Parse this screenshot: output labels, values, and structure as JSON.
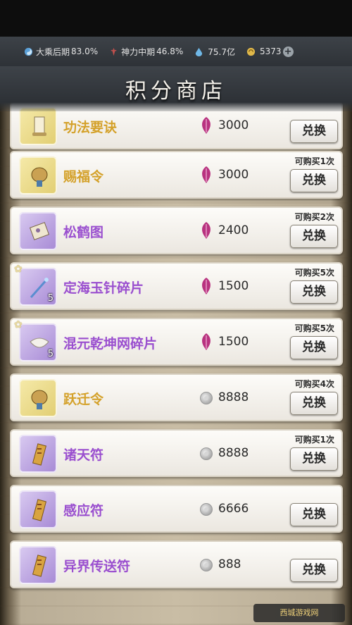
{
  "resources": [
    {
      "icon": "cultivation-icon",
      "label": "大乘后期",
      "value": "83.0%",
      "color": "#5aa0d8"
    },
    {
      "icon": "divine-power-icon",
      "label": "神力中期",
      "value": "46.8%",
      "color": "#c0504d"
    },
    {
      "icon": "spirit-drop-icon",
      "label": "",
      "value": "75.7亿",
      "color": "#6fb7e6"
    },
    {
      "icon": "gold-coin-icon",
      "label": "",
      "value": "5373",
      "color": "#e0b84a"
    }
  ],
  "shop": {
    "title": "积分商店",
    "items": [
      {
        "name": "功法要诀",
        "price": "3000",
        "currency": "points-feather-icon",
        "limit": "",
        "qty": "",
        "rarity": "yellow",
        "starred": false,
        "thumb_icon": "scroll-icon"
      },
      {
        "name": "赐福令",
        "price": "3000",
        "currency": "points-feather-icon",
        "limit": "可购买1次",
        "qty": "",
        "rarity": "yellow",
        "starred": false,
        "thumb_icon": "token-icon"
      },
      {
        "name": "松鹤图",
        "price": "2400",
        "currency": "points-feather-icon",
        "limit": "可购买2次",
        "qty": "",
        "rarity": "purple",
        "starred": false,
        "thumb_icon": "painting-icon"
      },
      {
        "name": "定海玉针碎片",
        "price": "1500",
        "currency": "points-feather-icon",
        "limit": "可购买5次",
        "qty": "5",
        "rarity": "purple",
        "starred": true,
        "thumb_icon": "needle-icon"
      },
      {
        "name": "混元乾坤网碎片",
        "price": "1500",
        "currency": "points-feather-icon",
        "limit": "可购买5次",
        "qty": "5",
        "rarity": "purple",
        "starred": true,
        "thumb_icon": "net-icon"
      },
      {
        "name": "跃迁令",
        "price": "8888",
        "currency": "silver-coin-icon",
        "limit": "可购买4次",
        "qty": "",
        "rarity": "yellow",
        "starred": false,
        "thumb_icon": "token-icon"
      },
      {
        "name": "诸天符",
        "price": "8888",
        "currency": "silver-coin-icon",
        "limit": "可购买1次",
        "qty": "",
        "rarity": "purple",
        "starred": false,
        "thumb_icon": "talisman-icon"
      },
      {
        "name": "感应符",
        "price": "6666",
        "currency": "silver-coin-icon",
        "limit": "",
        "qty": "",
        "rarity": "purple",
        "starred": false,
        "thumb_icon": "talisman-icon"
      },
      {
        "name": "异界传送符",
        "price": "888",
        "currency": "silver-coin-icon",
        "limit": "",
        "qty": "",
        "rarity": "purple",
        "starred": false,
        "thumb_icon": "talisman-icon"
      }
    ],
    "buy_label": "兑换"
  },
  "watermark": "西城游戏网"
}
